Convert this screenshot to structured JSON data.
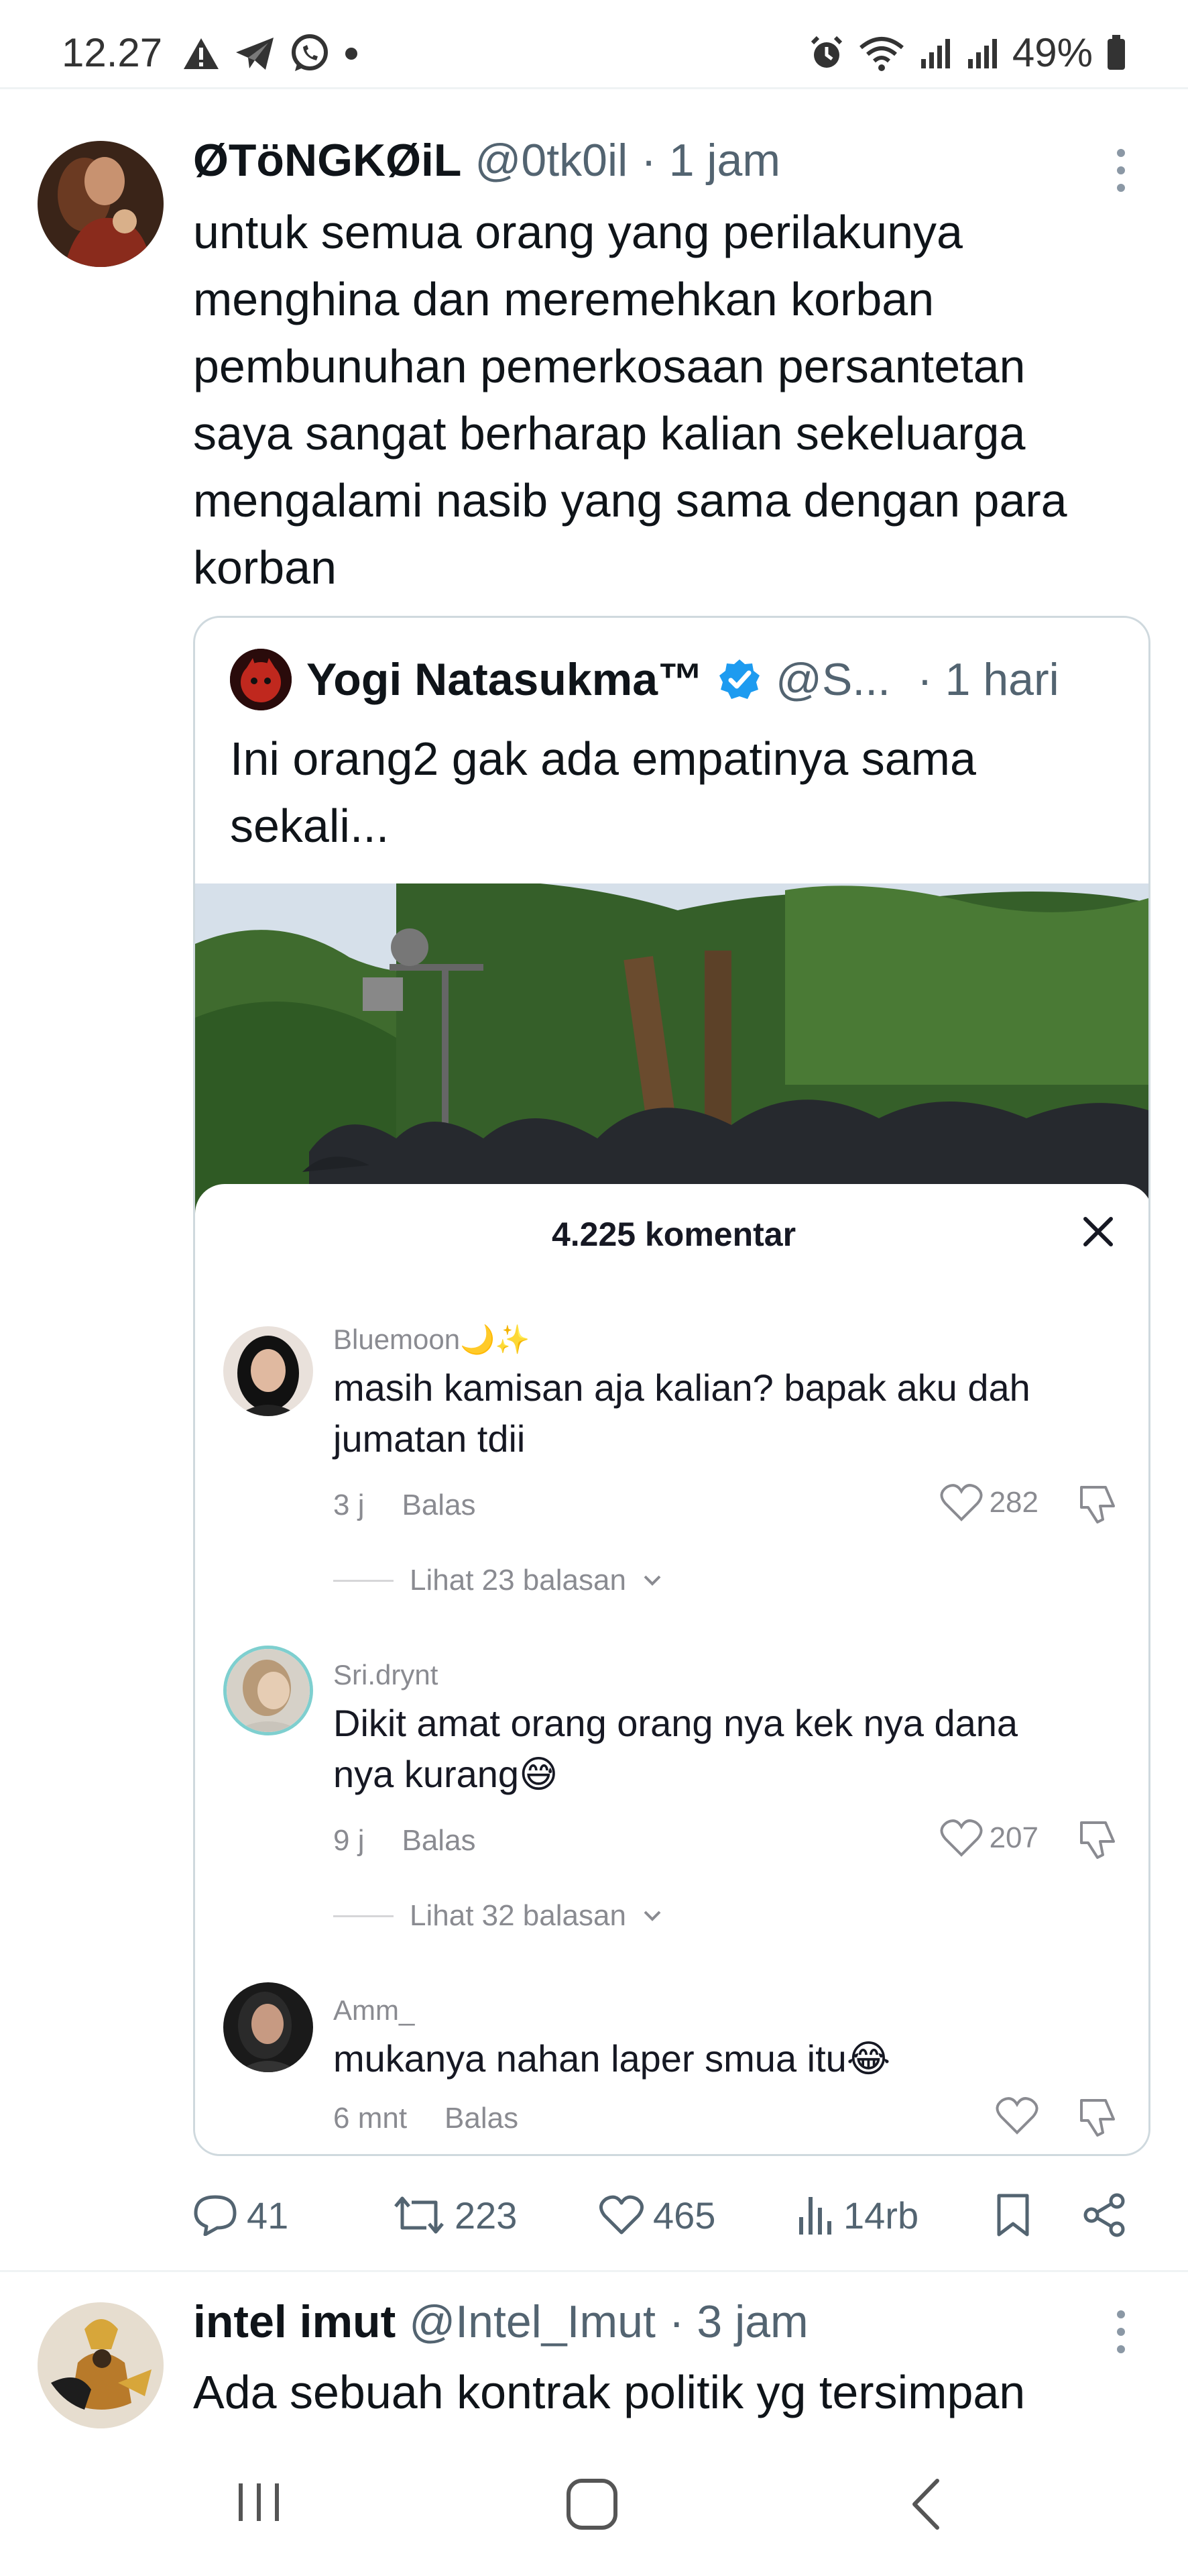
{
  "status_bar": {
    "time": "12.27",
    "battery": "49%"
  },
  "tweets": [
    {
      "name": "ØTöNGKØiL",
      "handle": "@0tk0il",
      "time": "· 1 jam",
      "lines": [
        "untuk semua orang yang perilakunya",
        "menghina dan meremehkan korban",
        "pembunuhan pemerkosaan persantetan",
        "saya sangat berharap kalian sekeluarga",
        "mengalami nasib yang sama dengan para",
        "korban"
      ],
      "quote": {
        "name": "Yogi Natasukma™",
        "handle": "@S...",
        "time": "· 1 hari",
        "lines": [
          "Ini orang2 gak ada empatinya sama",
          "sekali..."
        ],
        "comments_sheet": {
          "title": "4.225 komentar",
          "comments": [
            {
              "user": "Bluemoon🌙✨",
              "lines": [
                "masih kamisan aja kalian? bapak aku dah",
                "jumatan tdii"
              ],
              "age": "3 j",
              "reply": "Balas",
              "likes": "282",
              "replies": "Lihat 23 balasan"
            },
            {
              "user": "Sri.drynt",
              "lines": [
                "Dikit amat orang orang nya kek nya dana",
                "nya kurang😅"
              ],
              "age": "9 j",
              "reply": "Balas",
              "likes": "207",
              "replies": "Lihat 32 balasan"
            },
            {
              "user": "Amm_",
              "lines": [
                "mukanya nahan laper smua itu😂"
              ],
              "age": "6 mnt",
              "reply": "Balas",
              "likes": ""
            }
          ]
        }
      },
      "stats": {
        "replies": "41",
        "retweets": "223",
        "likes": "465",
        "views": "14rb"
      }
    },
    {
      "name": "intel imut",
      "handle": "@Intel_Imut",
      "time": "· 3 jam",
      "lines": [
        "Ada sebuah kontrak politik yg tersimpan"
      ]
    }
  ],
  "icons": {
    "status_left": [
      "warning-icon",
      "telegram-icon",
      "whatsapp-icon",
      "dot-icon"
    ],
    "status_right": [
      "alarm-icon",
      "wifi-icon",
      "signal-icon",
      "signal-icon",
      "battery-icon"
    ],
    "actions": [
      "reply-icon",
      "retweet-icon",
      "like-icon",
      "views-icon",
      "bookmark-icon",
      "share-icon"
    ],
    "nav": [
      "recents-icon",
      "home-icon",
      "back-icon"
    ]
  },
  "colors": {
    "verified": "#1d9bf0",
    "text": "#0f1419",
    "muted": "#536471",
    "border": "#cfd9de"
  }
}
